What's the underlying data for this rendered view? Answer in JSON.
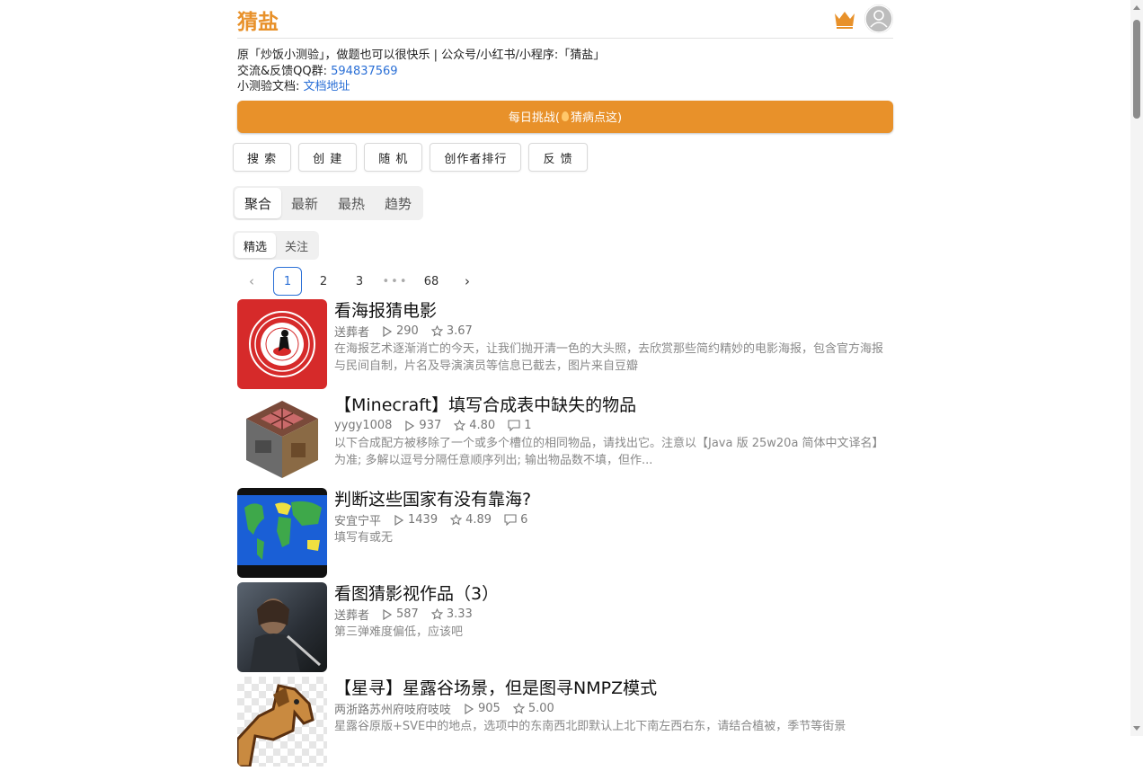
{
  "header": {
    "logo": "猜盐",
    "crown_icon": "crown-icon",
    "avatar_icon": "user-avatar-icon"
  },
  "info": {
    "line1": "原「炒饭小测验」，做题也可以很快乐 | 公众号/小红书/小程序:「猜盐」",
    "qq_label": "交流&反馈QQ群: ",
    "qq_value": "594837569",
    "doc_label": "小测验文档: ",
    "doc_link": "文档地址"
  },
  "daily": {
    "prefix": "每日挑战(",
    "suffix": "猜病点这)"
  },
  "buttons": [
    "搜 索",
    "创 建",
    "随 机",
    "创作者排行",
    "反 馈"
  ],
  "tabs": [
    "聚合",
    "最新",
    "最热",
    "趋势"
  ],
  "subtabs": [
    "精选",
    "关注"
  ],
  "pager": {
    "pages": [
      "1",
      "2",
      "3",
      "68"
    ],
    "dots": "•••",
    "current": "1"
  },
  "items": [
    {
      "title": "看海报猜电影",
      "author": "送葬者",
      "plays": "290",
      "rating": "3.67",
      "comments": "",
      "desc": "在海报艺术逐渐消亡的今天，让我们抛开清一色的大头照，去欣赏那些简约精妙的电影海报，包含官方海报与民间自制，片名及导演演员等信息已截去，图片来自豆瓣"
    },
    {
      "title": "【Minecraft】填写合成表中缺失的物品",
      "author": "yygy1008",
      "plays": "937",
      "rating": "4.80",
      "comments": "1",
      "desc": "以下合成配方被移除了一个或多个槽位的相同物品，请找出它。注意以【Java 版 25w20a 简体中文译名】为准; 多解以逗号分隔任意顺序列出; 输出物品数不填，但作..."
    },
    {
      "title": "判断这些国家有没有靠海?",
      "author": "安宜宁平",
      "plays": "1439",
      "rating": "4.89",
      "comments": "6",
      "desc": "填写有或无"
    },
    {
      "title": "看图猜影视作品（3）",
      "author": "送葬者",
      "plays": "587",
      "rating": "3.33",
      "comments": "",
      "desc": "第三弹难度偏低，应该吧"
    },
    {
      "title": "【星寻】星露谷场景，但是图寻NMPZ模式",
      "author": "两浙路苏州府吱府吱吱",
      "plays": "905",
      "rating": "5.00",
      "comments": "",
      "desc": "星露谷原版+SVE中的地点，选项中的东南西北即默认上北下南左西右东，请结合植被，季节等街景"
    }
  ],
  "colors": {
    "accent": "#e8912a",
    "link": "#2a6fd6"
  }
}
